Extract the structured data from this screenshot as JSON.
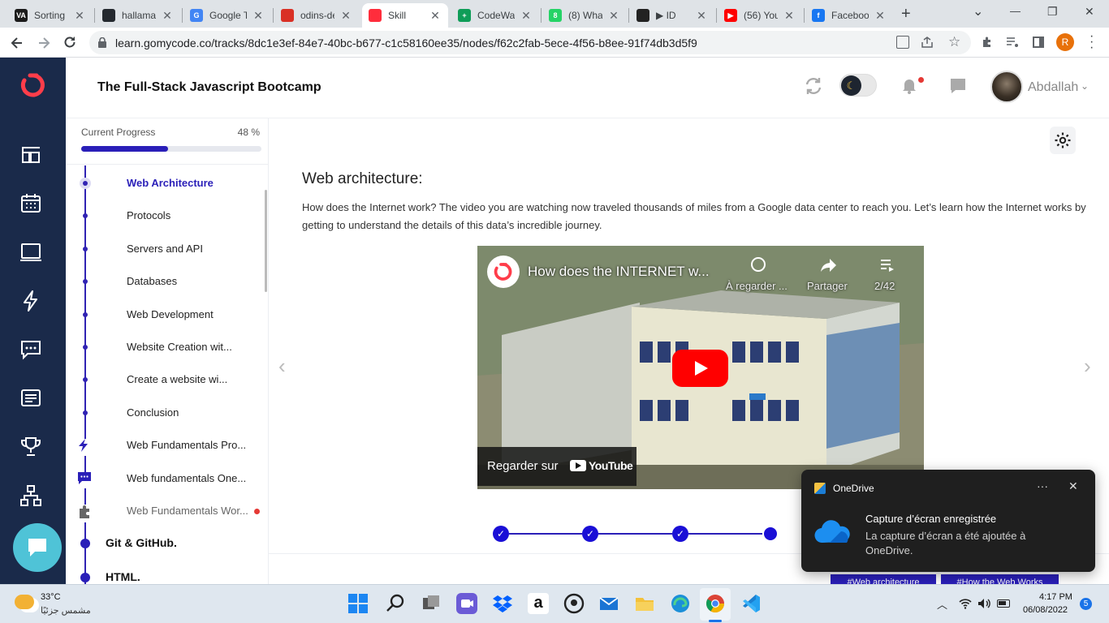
{
  "browser": {
    "tabs": [
      {
        "label": "Sorting (",
        "fav_text": "VA",
        "fav_color": "#1b1b1b"
      },
      {
        "label": "hallamac",
        "fav_text": "",
        "fav_color": "#24292f"
      },
      {
        "label": "Google T",
        "fav_text": "G",
        "fav_color": "#4285f4"
      },
      {
        "label": "odins-de",
        "fav_text": "",
        "fav_color": "#d93025"
      },
      {
        "label": "Skill",
        "fav_text": "",
        "fav_color": "#ff2d3c"
      },
      {
        "label": "CodeWa",
        "fav_text": "+",
        "fav_color": "#0f9d58"
      },
      {
        "label": "(8) What",
        "fav_text": "8",
        "fav_color": "#25d366"
      },
      {
        "label": "▶ ID",
        "fav_text": "",
        "fav_color": "#222"
      },
      {
        "label": "(56) You",
        "fav_text": "▶",
        "fav_color": "#ff0000"
      },
      {
        "label": "Faceboo",
        "fav_text": "f",
        "fav_color": "#1877f2"
      }
    ],
    "new_tab": "+",
    "url": "learn.gomycode.co/tracks/8dc1e3ef-84e7-40bc-b677-c1c58160ee35/nodes/f62c2fab-5ece-4f56-b8ee-91f74db3d5f9",
    "profile_initial": "R",
    "window_controls": [
      "⌄",
      "—",
      "❐",
      "✕"
    ]
  },
  "header": {
    "course_title": "The Full-Stack Javascript Bootcamp",
    "username": "Abdallah"
  },
  "progress": {
    "label": "Current Progress",
    "percent_text": "48 %",
    "value": 0.48
  },
  "tree": {
    "items": [
      {
        "label": "Web Architecture",
        "active": true
      },
      {
        "label": "Protocols"
      },
      {
        "label": "Servers and API"
      },
      {
        "label": "Databases"
      },
      {
        "label": "Web Development"
      },
      {
        "label": "Website Creation wit..."
      },
      {
        "label": "Create a website wi..."
      },
      {
        "label": "Conclusion"
      },
      {
        "label": "Web Fundamentals Pro...",
        "icon": "lightning-icon"
      },
      {
        "label": "Web fundamentals One...",
        "icon": "chat-icon"
      },
      {
        "label": "Web Fundamentals Wor...",
        "icon": "puzzle-icon"
      }
    ],
    "sections": [
      "Git & GitHub.",
      "HTML."
    ]
  },
  "lesson": {
    "title": "Web architecture:",
    "text": "How does the Internet work? The video you are watching now traveled thousands of miles from a Google data center to reach you. Let’s learn how the Internet works by getting to understand the details of this data’s incredible journey."
  },
  "video": {
    "title": "How does the INTERNET w...",
    "watch_later": "À regarder ...",
    "share": "Partager",
    "playlist_count": "2/42",
    "watch_on": "Regarder sur",
    "youtube_label": "YouTube"
  },
  "steps": {
    "completed": 3,
    "current_index": 3
  },
  "tags": [
    "#Web architecture",
    "#How the Web Works"
  ],
  "toast": {
    "app": "OneDrive",
    "more": "···",
    "heading": "Capture d’écran enregistrée",
    "body": "La capture d’écran a été ajoutée à OneDrive."
  },
  "taskbar": {
    "weather_temp": "33°C",
    "weather_desc": "مشمس جزئيًا",
    "time": "4:17 PM",
    "date": "06/08/2022",
    "notification_count": "5"
  },
  "colors": {
    "brand_red": "#ff3d4a",
    "nav_bg": "#1a2a4a",
    "accent_blue": "#2a1fb8"
  }
}
